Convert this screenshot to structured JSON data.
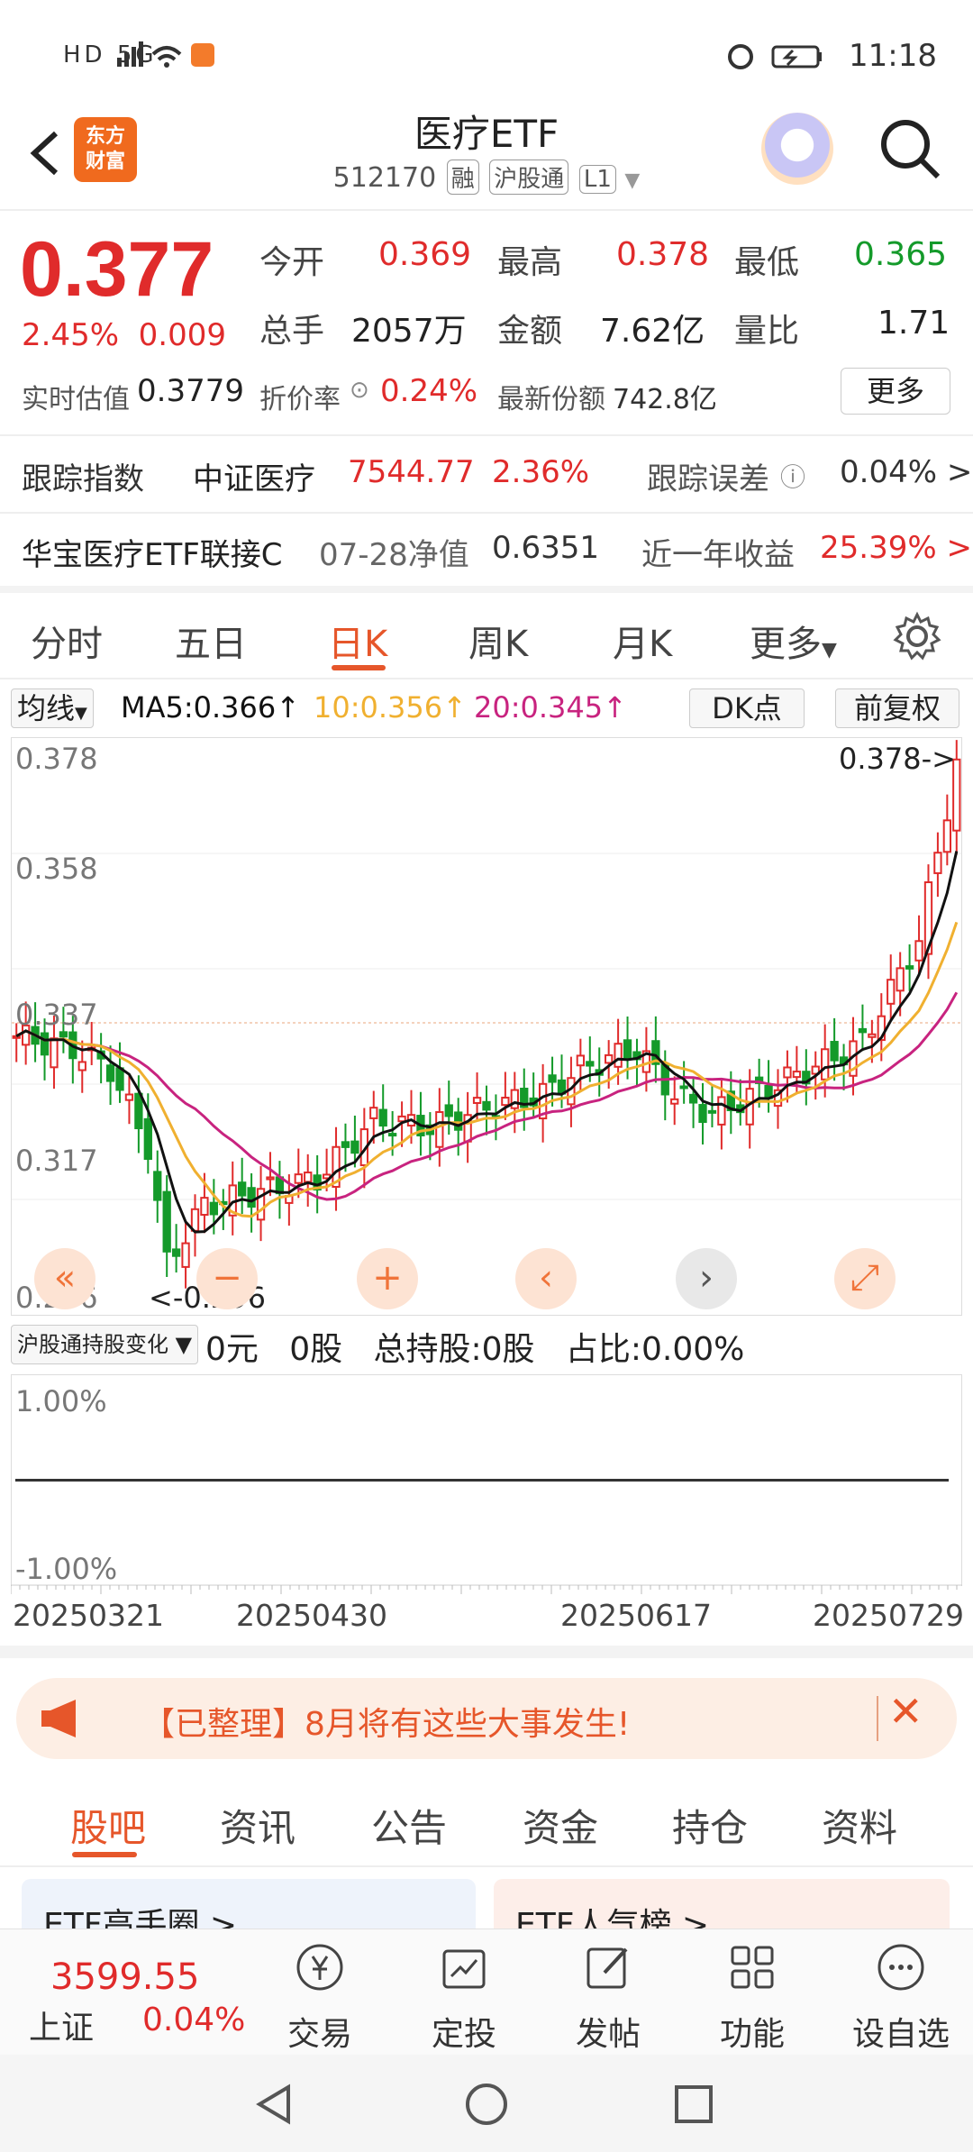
{
  "status_bar": {
    "network": "HD 5G",
    "time": "11:18"
  },
  "header": {
    "logo_line1": "东方",
    "logo_line2": "财富",
    "title": "医疗ETF",
    "code": "512170",
    "tag_margin": "融",
    "tag_connect": "沪股通",
    "tag_level": "L1"
  },
  "quote": {
    "price": "0.377",
    "change_pct": "2.45%",
    "change_abs": "0.009",
    "open_label": "今开",
    "open": "0.369",
    "high_label": "最高",
    "high": "0.378",
    "low_label": "最低",
    "low": "0.365",
    "volume_label": "总手",
    "volume": "2057万",
    "amount_label": "金额",
    "amount": "7.62亿",
    "ratio_label": "量比",
    "ratio": "1.71",
    "iopv_label": "实时估值",
    "iopv": "0.3779",
    "premium_label": "折价率",
    "premium": "0.24%",
    "shares_label": "最新份额",
    "shares": "742.8亿",
    "more_button": "更多"
  },
  "tracking": {
    "label": "跟踪指数",
    "index_name": "中证医疗",
    "index_value": "7544.77",
    "index_change": "2.36%",
    "error_label": "跟踪误差",
    "error_value": "0.04% >"
  },
  "linked_fund": {
    "name": "华宝医疗ETF联接C",
    "nav_label": "07-28净值",
    "nav": "0.6351",
    "return_label": "近一年收益",
    "return_value": "25.39% >"
  },
  "chart_tabs": [
    "分时",
    "五日",
    "日K",
    "周K",
    "月K",
    "更多"
  ],
  "chart_controls": {
    "ma_select": "均线",
    "ma5": "MA5:0.366↑",
    "ma10": "10:0.356↑",
    "ma20": "20:0.345↑",
    "dk_button": "DK点",
    "adjust_button": "前复权"
  },
  "kline_axis": {
    "y_labels": [
      "0.378",
      "0.358",
      "0.337",
      "0.317",
      "0.296"
    ],
    "max_marker": "0.378->",
    "min_marker": "<-0.296"
  },
  "holding_panel": {
    "select": "沪股通持股变化",
    "amount": "0元",
    "shares": "0股",
    "total": "总持股:0股",
    "ratio": "占比:0.00%",
    "y_top": "1.00%",
    "y_bottom": "-1.00%"
  },
  "x_dates": [
    "20250321",
    "20250430",
    "20250617",
    "20250729"
  ],
  "notice": {
    "text": "【已整理】8月将有这些大事发生!"
  },
  "content_tabs": [
    "股吧",
    "资讯",
    "公告",
    "资金",
    "持仓",
    "资料"
  ],
  "cards": [
    "ETF高手圈 >",
    "ETF人气榜 >"
  ],
  "toolbar": {
    "index_value": "3599.55",
    "index_name": "上证",
    "index_change": "0.04%",
    "items": [
      "交易",
      "定投",
      "发帖",
      "功能",
      "设自选"
    ]
  },
  "colors": {
    "up": "#e02b2b",
    "down": "#149a2a",
    "accent": "#e6562a",
    "ma5": "#111111",
    "ma10": "#f0b030",
    "ma20": "#c8237f"
  },
  "chart_data": {
    "type": "candlestick",
    "series": [
      {
        "name": "MA5",
        "values": [
          0.33,
          0.335,
          0.33,
          0.312,
          0.305,
          0.309,
          0.311,
          0.318,
          0.321,
          0.322,
          0.324,
          0.331,
          0.325,
          0.323,
          0.33,
          0.34,
          0.354,
          0.366
        ]
      },
      {
        "name": "MA10",
        "values": [
          0.341,
          0.334,
          0.318,
          0.31,
          0.31,
          0.313,
          0.317,
          0.319,
          0.321,
          0.328,
          0.326,
          0.322,
          0.326,
          0.329,
          0.336,
          0.344,
          0.356
        ]
      },
      {
        "name": "MA20",
        "values": [
          0.342,
          0.338,
          0.326,
          0.313,
          0.31,
          0.311,
          0.314,
          0.316,
          0.319,
          0.321,
          0.323,
          0.324,
          0.325,
          0.327,
          0.332,
          0.338,
          0.345
        ]
      }
    ],
    "ylim": [
      0.296,
      0.378
    ]
  }
}
